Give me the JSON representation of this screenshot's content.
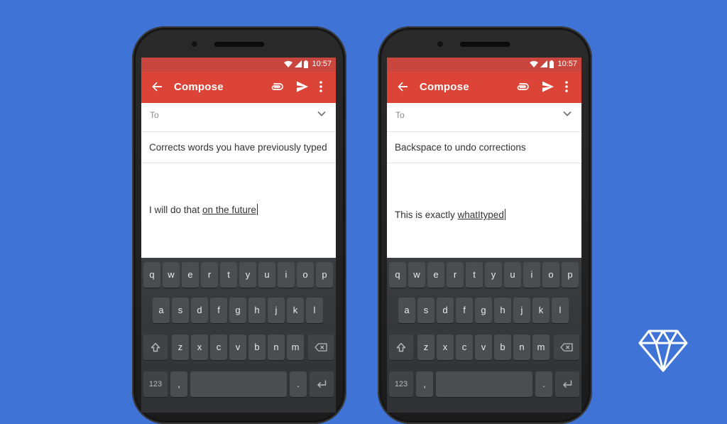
{
  "status_bar": {
    "time": "10:57"
  },
  "toolbar": {
    "title": "Compose"
  },
  "compose": {
    "to_label": "To"
  },
  "phones": [
    {
      "subject": "Corrects words you have previously typed",
      "body_prefix": "I will do that ",
      "body_corrected": "on the future"
    },
    {
      "subject": "Backspace to undo corrections",
      "body_prefix": "This is exactly ",
      "body_corrected": "whatItyped"
    }
  ],
  "keyboard": {
    "row1": [
      "q",
      "w",
      "e",
      "r",
      "t",
      "y",
      "u",
      "i",
      "o",
      "p"
    ],
    "row2": [
      "a",
      "s",
      "d",
      "f",
      "g",
      "h",
      "j",
      "k",
      "l"
    ],
    "row3": [
      "z",
      "x",
      "c",
      "v",
      "b",
      "n",
      "m"
    ],
    "symbols_label": "123",
    "comma": ",",
    "period": "."
  },
  "colors": {
    "background": "#3f74d6",
    "toolbar": "#db4437",
    "status_bar": "#c9463e",
    "keyboard": "#2f3234",
    "key": "#4a4e51"
  },
  "icons": [
    "back-arrow-icon",
    "attachment-icon",
    "send-icon",
    "more-vert-icon",
    "chevron-down-icon",
    "shift-icon",
    "backspace-icon",
    "enter-icon",
    "wifi-icon",
    "signal-icon",
    "battery-icon",
    "diamond-logo-icon"
  ]
}
